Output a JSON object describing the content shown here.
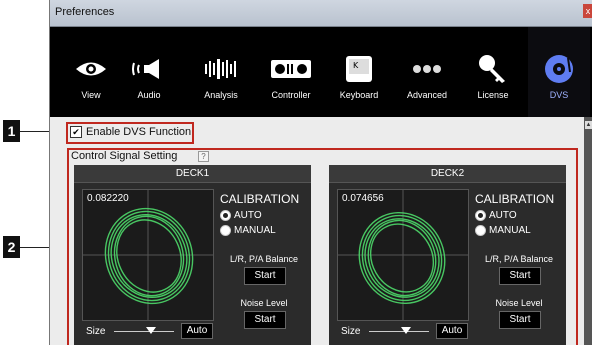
{
  "window": {
    "title": "Preferences",
    "close_label": "x"
  },
  "toolbar": {
    "items": [
      {
        "label": "View",
        "icon": "eye-icon"
      },
      {
        "label": "Audio",
        "icon": "speaker-icon"
      },
      {
        "label": "Analysis",
        "icon": "waveform-icon"
      },
      {
        "label": "Controller",
        "icon": "controller-icon"
      },
      {
        "label": "Keyboard",
        "icon": "keyboard-icon"
      },
      {
        "label": "Advanced",
        "icon": "dots-icon"
      },
      {
        "label": "License",
        "icon": "key-icon"
      },
      {
        "label": "DVS",
        "icon": "vinyl-icon"
      }
    ],
    "active": "DVS"
  },
  "dvs": {
    "enable_label": "Enable DVS Function",
    "enabled": true
  },
  "control_signal": {
    "title": "Control Signal Setting",
    "help_label": "?"
  },
  "decks": [
    {
      "name": "DECK1",
      "value": "0.082220",
      "calibration": "CALIBRATION",
      "auto_label": "AUTO",
      "manual_label": "MANUAL",
      "balance_label": "L/R, P/A Balance",
      "start_label": "Start",
      "noise_label": "Noise Level",
      "noise_start_label": "Start",
      "size_label": "Size",
      "size_auto_label": "Auto",
      "mode": "AUTO"
    },
    {
      "name": "DECK2",
      "value": "0.074656",
      "calibration": "CALIBRATION",
      "auto_label": "AUTO",
      "manual_label": "MANUAL",
      "balance_label": "L/R, P/A Balance",
      "start_label": "Start",
      "noise_label": "Noise Level",
      "noise_start_label": "Start",
      "size_label": "Size",
      "size_auto_label": "Auto",
      "mode": "AUTO"
    }
  ],
  "callouts": [
    {
      "label": "1"
    },
    {
      "label": "2"
    }
  ],
  "colors": {
    "callout_border": "#c0281f",
    "signal_green": "#4dd96a",
    "dvs_accent": "#5f7df2"
  }
}
